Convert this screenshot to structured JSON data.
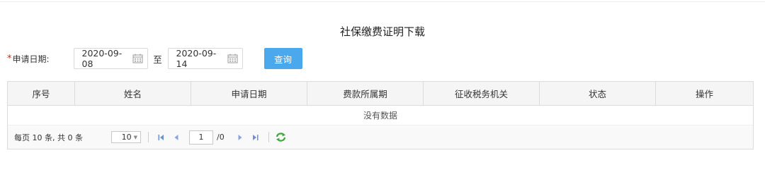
{
  "title": "社保缴费证明下载",
  "form": {
    "required_mark": "*",
    "date_label": "申请日期:",
    "start_date": "2020-09-08",
    "to_label": "至",
    "end_date": "2020-09-14",
    "query_button": "查询"
  },
  "table": {
    "columns": [
      "序号",
      "姓名",
      "申请日期",
      "费款所属期",
      "征收税务机关",
      "状态",
      "操作"
    ],
    "empty_text": "没有数据"
  },
  "pager": {
    "info": "每页 10 条, 共 0 条",
    "page_size": "10",
    "current_page": "1",
    "total_pages": "/0"
  },
  "colors": {
    "accent": "#4aa8ec",
    "required": "#e02020",
    "pager_icon": "#6f8fd6",
    "refresh_icon": "#3ea83e"
  },
  "icons": [
    "calendar-icon",
    "first-page-icon",
    "prev-page-icon",
    "next-page-icon",
    "last-page-icon",
    "refresh-icon",
    "dropdown-caret-icon"
  ]
}
